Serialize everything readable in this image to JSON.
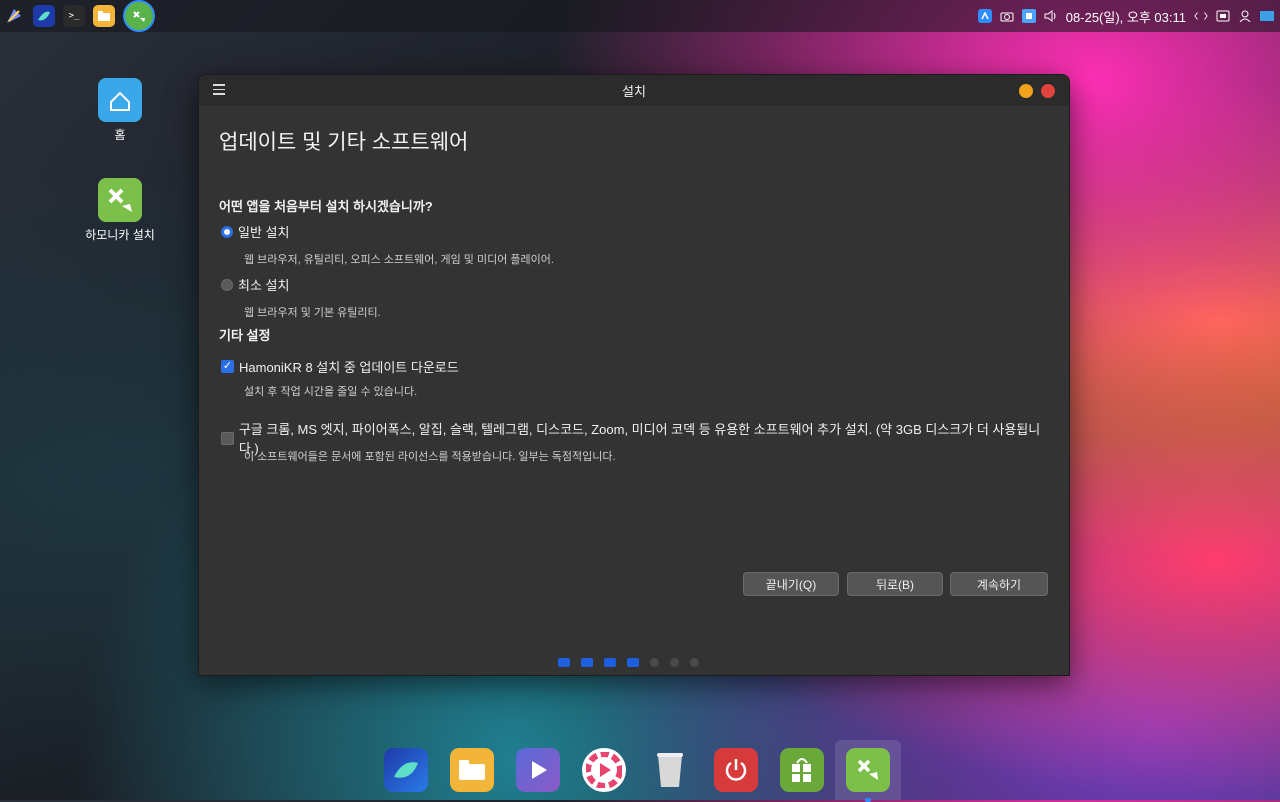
{
  "topbar": {
    "apps": [
      {
        "name": "app-menu-icon"
      },
      {
        "name": "whale-browser-icon"
      },
      {
        "name": "terminal-icon",
        "glyph": ">_"
      },
      {
        "name": "files-icon"
      },
      {
        "name": "hamonika-installer-icon"
      }
    ],
    "clock": "08-25(일), 오후 03:11",
    "colors": {
      "accent": "#2f8cff"
    }
  },
  "desktop": {
    "icons": [
      {
        "label": "홈"
      },
      {
        "label": "하모니카 설치"
      }
    ]
  },
  "window": {
    "title": "설치",
    "heading": "업데이트 및 기타 소프트웨어",
    "question": "어떤 앱을 처음부터 설치 하시겠습니까?",
    "options": [
      {
        "label": "일반 설치",
        "selected": true,
        "desc": "웹 브라우저, 유틸리티, 오피스  소프트웨어, 게임 및 미디어 플레이어."
      },
      {
        "label": "최소 설치",
        "selected": false,
        "desc": "웹 브라우저 및 기본 유틸리티."
      }
    ],
    "other_title": "기타 설정",
    "checks": [
      {
        "label": "HamoniKR 8 설치 중 업데이트 다운로드",
        "checked": true,
        "desc": "설치 후 작업 시간을 줄일 수 있습니다."
      },
      {
        "label": "구글 크롬, MS 엣지, 파이어폭스, 알집, 슬랙, 텔레그램, 디스코드, Zoom, 미디어 코덱 등 유용한 소프트웨어 추가 설치. (약 3GB 디스크가 더 사용됩니다.)",
        "checked": false,
        "desc": "이 소프트웨어들은 문서에 포함된 라이선스를 적용받습니다. 일부는 독점적입니다."
      }
    ],
    "buttons": {
      "quit": "끝내기(Q)",
      "back": "뒤로(B)",
      "continue": "계속하기"
    },
    "progress": {
      "total": 7,
      "done": 4
    }
  },
  "dock": {
    "items": [
      "whale-browser",
      "files",
      "video-player",
      "media-app",
      "trash",
      "power",
      "software-store",
      "hamonika-installer"
    ]
  }
}
